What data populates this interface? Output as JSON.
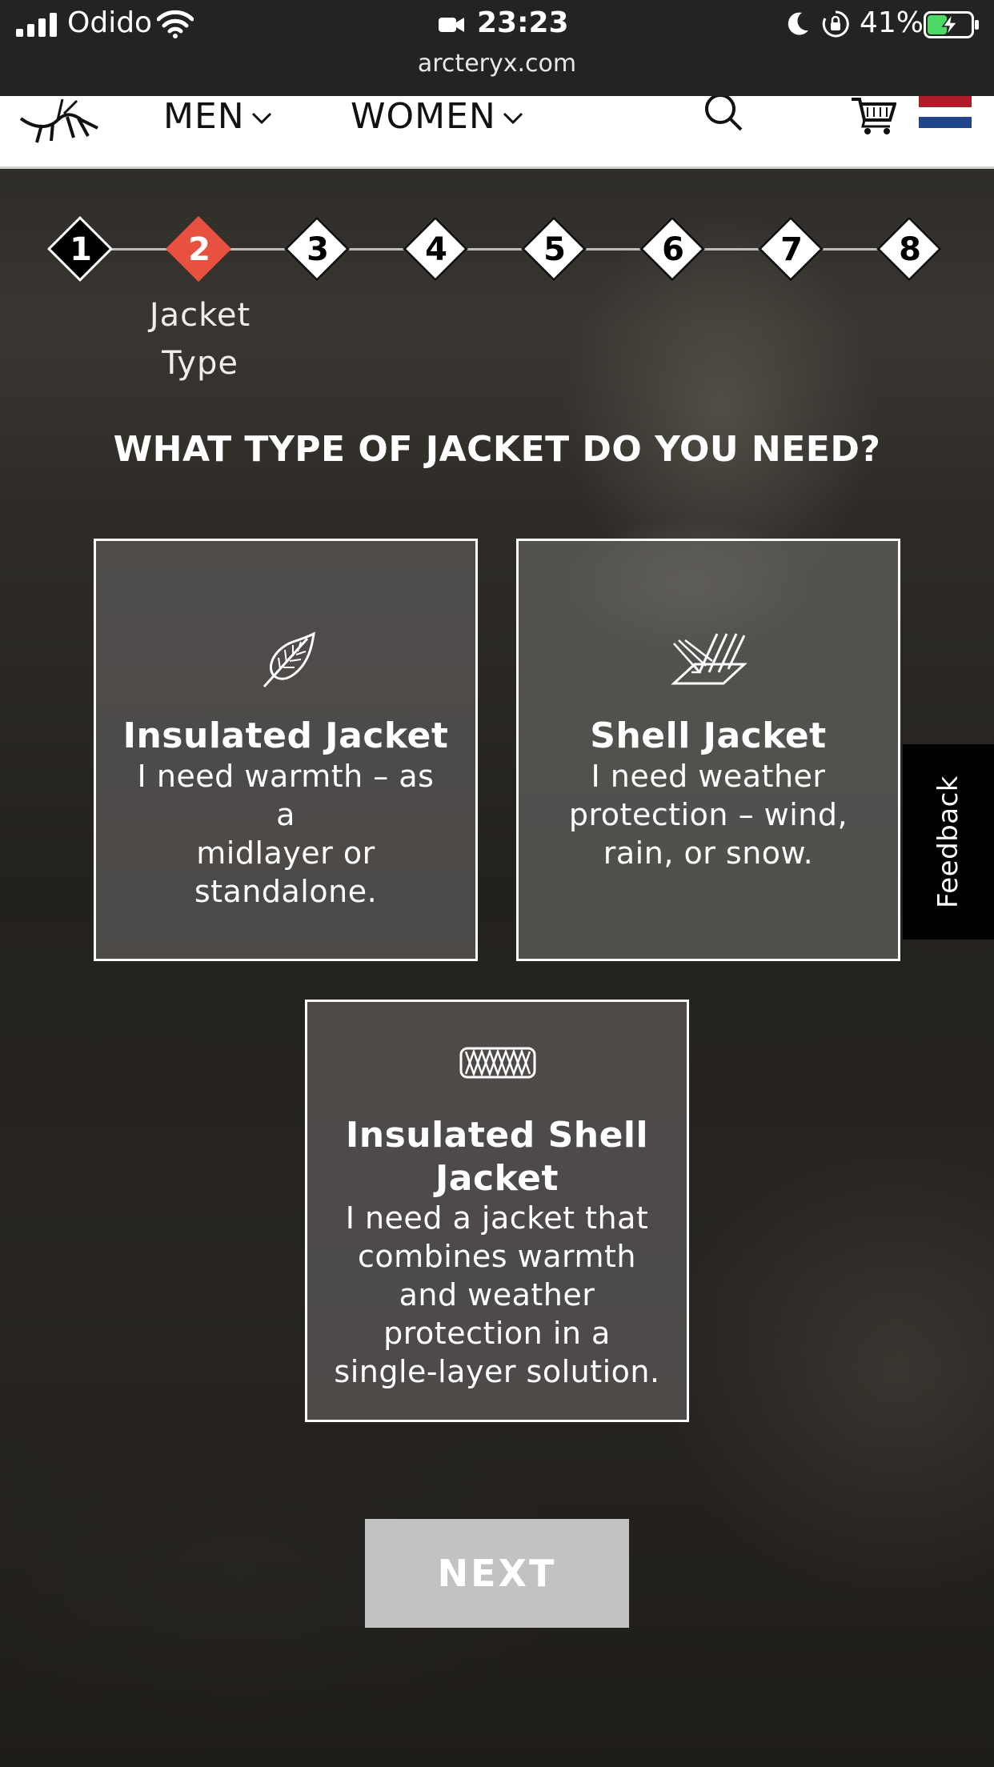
{
  "status_bar": {
    "carrier": "Odido",
    "time": "23:23",
    "battery_percent": "41%",
    "signal_bars": 4,
    "battery_level": 0.41,
    "battery_charging": true
  },
  "browser": {
    "url": "arcteryx.com"
  },
  "header": {
    "nav": [
      {
        "label": "MEN"
      },
      {
        "label": "WOMEN"
      }
    ],
    "icons": [
      "arcteryx-logo-icon",
      "search-icon",
      "cart-icon",
      "netherlands-flag-icon"
    ]
  },
  "steps": {
    "items": [
      "1",
      "2",
      "3",
      "4",
      "5",
      "6",
      "7",
      "8"
    ],
    "active_index": 1,
    "active_label_line1": "Jacket",
    "active_label_line2": "Type",
    "active_color": "#e8503f"
  },
  "question": "WHAT TYPE OF JACKET DO YOU NEED?",
  "options": [
    {
      "icon": "feather-icon",
      "title": "Insulated Jacket",
      "desc_lines": [
        "I need warmth – as a",
        "midlayer or",
        "standalone."
      ]
    },
    {
      "icon": "rain-surface-icon",
      "title": "Shell Jacket",
      "desc_lines": [
        "I need weather",
        "protection – wind,",
        "rain, or snow."
      ]
    },
    {
      "icon": "insulation-baffle-icon",
      "title_lines": [
        "Insulated Shell",
        "Jacket"
      ],
      "desc_lines": [
        "I need a jacket that",
        "combines warmth",
        "and weather",
        "protection in a",
        "single-layer solution."
      ]
    }
  ],
  "feedback_tab": "Feedback",
  "next_button": "NEXT"
}
